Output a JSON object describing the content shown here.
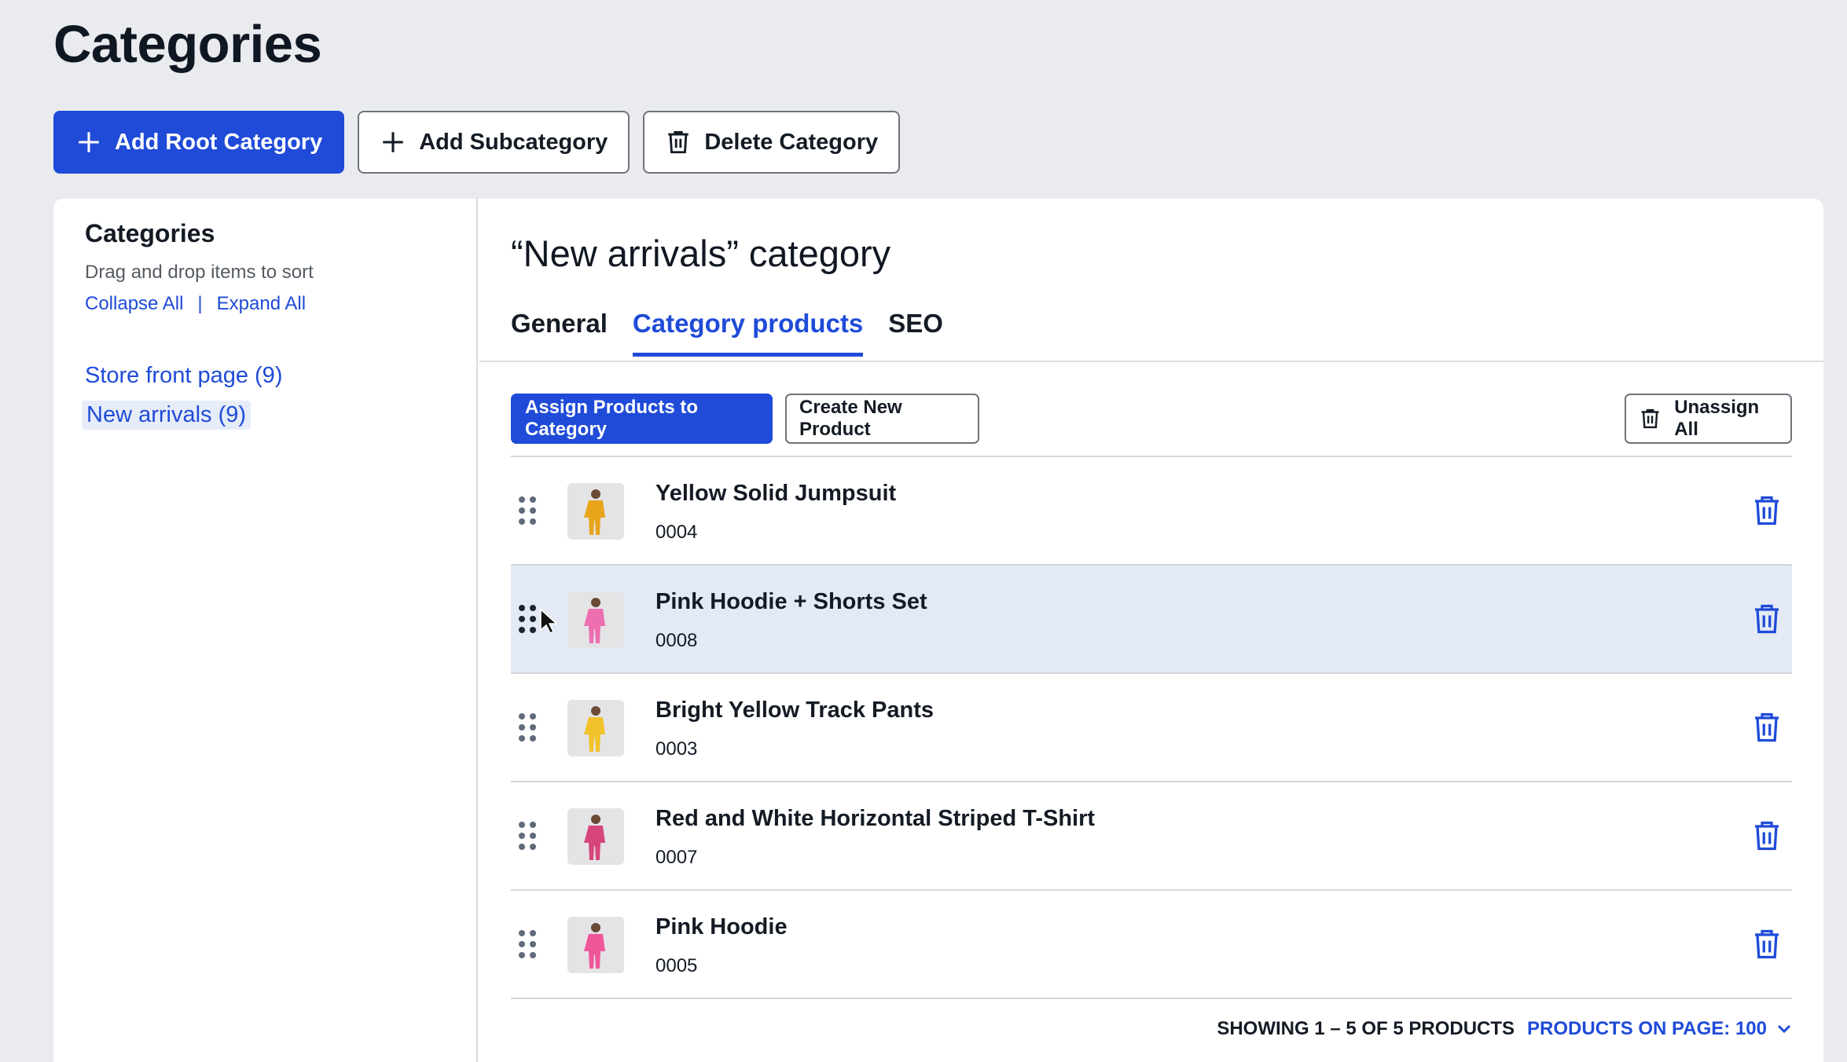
{
  "page": {
    "title": "Categories"
  },
  "toolbar": {
    "add_root": "Add Root Category",
    "add_sub": "Add Subcategory",
    "delete": "Delete Category"
  },
  "sidebar": {
    "title": "Categories",
    "hint": "Drag and drop items to sort",
    "collapse": "Collapse All",
    "separator": "|",
    "expand": "Expand All",
    "items": [
      {
        "label": "Store front page (9)"
      },
      {
        "label": "New arrivals (9)",
        "selected": true
      }
    ]
  },
  "main": {
    "heading": "“New arrivals” category",
    "tabs": [
      {
        "label": "General"
      },
      {
        "label": "Category products",
        "active": true
      },
      {
        "label": "SEO"
      }
    ],
    "actions": {
      "assign": "Assign Products to Category",
      "create": "Create New Product",
      "unassign": "Unassign All"
    },
    "products": [
      {
        "name": "Yellow Solid Jumpsuit",
        "sku": "0004",
        "thumb_color": "#e7a51c"
      },
      {
        "name": "Pink Hoodie + Shorts Set",
        "sku": "0008",
        "thumb_color": "#ee6fb0"
      },
      {
        "name": "Bright Yellow Track Pants",
        "sku": "0003",
        "thumb_color": "#f1c22b"
      },
      {
        "name": "Red and White Horizontal Striped T-Shirt",
        "sku": "0007",
        "thumb_color": "#d7467a"
      },
      {
        "name": "Pink Hoodie",
        "sku": "0005",
        "thumb_color": "#f0569a"
      }
    ],
    "footer": {
      "showing": "Showing 1 – 5 of 5 products",
      "per_page": "Products on page: 100"
    }
  },
  "colors": {
    "accent": "#1f4bd8",
    "hover_row": "#e3eaf5",
    "background": "#e9ebef"
  },
  "icons": {
    "plus": "plus-icon",
    "trash": "trash-icon",
    "drag": "drag-handle-icon",
    "chevron": "chevron-down-icon",
    "cursor": "mouse-pointer-icon"
  }
}
